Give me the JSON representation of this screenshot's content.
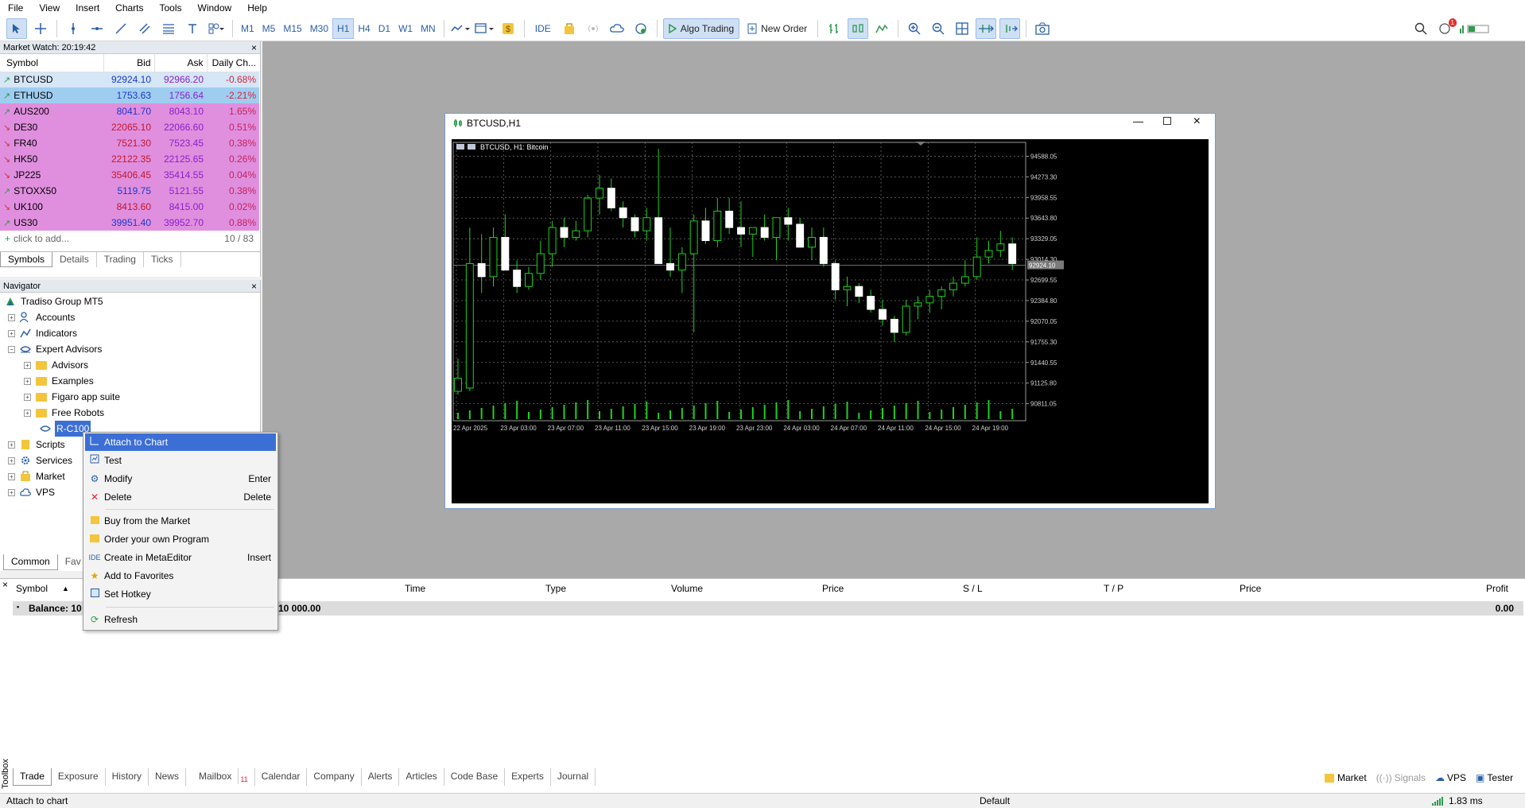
{
  "menubar": [
    "File",
    "View",
    "Insert",
    "Charts",
    "Tools",
    "Window",
    "Help"
  ],
  "toolbar": {
    "timeframes": [
      "M1",
      "M5",
      "M15",
      "M30",
      "H1",
      "H4",
      "D1",
      "W1",
      "MN"
    ],
    "active_timeframe": "H1",
    "ide_label": "IDE",
    "algo_trading_label": "Algo Trading",
    "new_order_label": "New Order",
    "notification_count": "1"
  },
  "market_watch": {
    "title": "Market Watch: 20:19:42",
    "headers": [
      "Symbol",
      "Bid",
      "Ask",
      "Daily Ch..."
    ],
    "rows": [
      {
        "symbol": "BTCUSD",
        "dir": "up",
        "bid": "92924.10",
        "ask": "92966.20",
        "change": "-0.68%"
      },
      {
        "symbol": "ETHUSD",
        "dir": "up",
        "bid": "1753.63",
        "ask": "1756.64",
        "change": "-2.21%"
      },
      {
        "symbol": "AUS200",
        "dir": "up",
        "bid": "8041.70",
        "ask": "8043.10",
        "change": "1.65%"
      },
      {
        "symbol": "DE30",
        "dir": "down",
        "bid": "22065.10",
        "ask": "22066.60",
        "change": "0.51%"
      },
      {
        "symbol": "FR40",
        "dir": "down",
        "bid": "7521.30",
        "ask": "7523.45",
        "change": "0.38%"
      },
      {
        "symbol": "HK50",
        "dir": "down",
        "bid": "22122.35",
        "ask": "22125.65",
        "change": "0.26%"
      },
      {
        "symbol": "JP225",
        "dir": "down",
        "bid": "35406.45",
        "ask": "35414.55",
        "change": "0.04%"
      },
      {
        "symbol": "STOXX50",
        "dir": "up",
        "bid": "5119.75",
        "ask": "5121.55",
        "change": "0.38%"
      },
      {
        "symbol": "UK100",
        "dir": "down",
        "bid": "8413.60",
        "ask": "8415.00",
        "change": "0.02%"
      },
      {
        "symbol": "US30",
        "dir": "up",
        "bid": "39951.40",
        "ask": "39952.70",
        "change": "0.88%"
      }
    ],
    "add_placeholder": "click to add...",
    "count": "10 / 83",
    "tabs": [
      "Symbols",
      "Details",
      "Trading",
      "Ticks"
    ]
  },
  "navigator": {
    "title": "Navigator",
    "root": "Tradiso Group MT5",
    "items": {
      "accounts": "Accounts",
      "indicators": "Indicators",
      "expert_advisors": "Expert Advisors",
      "advisors": "Advisors",
      "examples": "Examples",
      "figaro": "Figaro app suite",
      "free_robots": "Free Robots",
      "rc100": "R-C100",
      "scripts": "Scripts",
      "services": "Services",
      "market": "Market",
      "vps": "VPS"
    },
    "tabs": [
      "Common",
      "Fav"
    ]
  },
  "context_menu": {
    "items": [
      {
        "label": "Attach to Chart",
        "key": ""
      },
      {
        "label": "Test",
        "key": ""
      },
      {
        "label": "Modify",
        "key": "Enter"
      },
      {
        "label": "Delete",
        "key": "Delete"
      },
      {
        "label": "Buy from the Market",
        "key": ""
      },
      {
        "label": "Order your own Program",
        "key": ""
      },
      {
        "label": "Create in MetaEditor",
        "key": "Insert"
      },
      {
        "label": "Add to Favorites",
        "key": ""
      },
      {
        "label": "Set Hotkey",
        "key": ""
      },
      {
        "label": "Refresh",
        "key": ""
      }
    ]
  },
  "chart_window": {
    "title": "BTCUSD,H1",
    "label": "BTCUSD, H1:  Bitcoin",
    "current_price": "92924.10"
  },
  "chart_data": {
    "type": "candlestick",
    "price_ticks": [
      "94588.05",
      "94273.30",
      "93958.55",
      "93643.80",
      "93329.05",
      "93014.30",
      "92699.55",
      "92384.80",
      "92070.05",
      "91755.30",
      "91440.55",
      "91125.80",
      "90811.05"
    ],
    "time_ticks": [
      "22 Apr 2025",
      "23 Apr 03:00",
      "23 Apr 07:00",
      "23 Apr 11:00",
      "23 Apr 15:00",
      "23 Apr 19:00",
      "23 Apr 23:00",
      "24 Apr 03:00",
      "24 Apr 07:00",
      "24 Apr 11:00",
      "24 Apr 15:00",
      "24 Apr 19:00"
    ],
    "ylim": [
      90600,
      94800
    ],
    "candles": [
      {
        "o": 91000,
        "h": 91500,
        "l": 90950,
        "c": 91200
      },
      {
        "o": 91050,
        "h": 93500,
        "l": 91000,
        "c": 92950
      },
      {
        "o": 92950,
        "h": 93400,
        "l": 92500,
        "c": 92750
      },
      {
        "o": 92750,
        "h": 93500,
        "l": 92600,
        "c": 93350
      },
      {
        "o": 93350,
        "h": 93700,
        "l": 92900,
        "c": 92850
      },
      {
        "o": 92850,
        "h": 93000,
        "l": 92500,
        "c": 92600
      },
      {
        "o": 92600,
        "h": 92900,
        "l": 92550,
        "c": 92800
      },
      {
        "o": 92800,
        "h": 93300,
        "l": 92700,
        "c": 93100
      },
      {
        "o": 93100,
        "h": 93600,
        "l": 92900,
        "c": 93500
      },
      {
        "o": 93500,
        "h": 93650,
        "l": 93200,
        "c": 93350
      },
      {
        "o": 93350,
        "h": 93600,
        "l": 93300,
        "c": 93450
      },
      {
        "o": 93450,
        "h": 94000,
        "l": 93350,
        "c": 93950
      },
      {
        "o": 93950,
        "h": 94300,
        "l": 93700,
        "c": 94100
      },
      {
        "o": 94100,
        "h": 94250,
        "l": 93750,
        "c": 93800
      },
      {
        "o": 93800,
        "h": 93900,
        "l": 93500,
        "c": 93650
      },
      {
        "o": 93650,
        "h": 93700,
        "l": 93350,
        "c": 93450
      },
      {
        "o": 93450,
        "h": 93800,
        "l": 93300,
        "c": 93650
      },
      {
        "o": 93650,
        "h": 94700,
        "l": 92950,
        "c": 92950
      },
      {
        "o": 92950,
        "h": 93500,
        "l": 92750,
        "c": 92850
      },
      {
        "o": 92850,
        "h": 93200,
        "l": 92500,
        "c": 93100
      },
      {
        "o": 93100,
        "h": 93700,
        "l": 91900,
        "c": 93600
      },
      {
        "o": 93600,
        "h": 93800,
        "l": 93250,
        "c": 93300
      },
      {
        "o": 93300,
        "h": 93950,
        "l": 93200,
        "c": 93750
      },
      {
        "o": 93750,
        "h": 93950,
        "l": 93400,
        "c": 93500
      },
      {
        "o": 93500,
        "h": 93900,
        "l": 93200,
        "c": 93400
      },
      {
        "o": 93400,
        "h": 93500,
        "l": 93050,
        "c": 93500
      },
      {
        "o": 93500,
        "h": 93700,
        "l": 93300,
        "c": 93350
      },
      {
        "o": 93350,
        "h": 93650,
        "l": 93000,
        "c": 93650
      },
      {
        "o": 93650,
        "h": 93800,
        "l": 93300,
        "c": 93550
      },
      {
        "o": 93550,
        "h": 93650,
        "l": 93200,
        "c": 93200
      },
      {
        "o": 93200,
        "h": 93500,
        "l": 93000,
        "c": 93350
      },
      {
        "o": 93350,
        "h": 93500,
        "l": 92900,
        "c": 92950
      },
      {
        "o": 92950,
        "h": 93000,
        "l": 92400,
        "c": 92550
      },
      {
        "o": 92550,
        "h": 92750,
        "l": 92300,
        "c": 92600
      },
      {
        "o": 92600,
        "h": 92650,
        "l": 92350,
        "c": 92450
      },
      {
        "o": 92450,
        "h": 92550,
        "l": 92200,
        "c": 92250
      },
      {
        "o": 92250,
        "h": 92400,
        "l": 92000,
        "c": 92100
      },
      {
        "o": 92100,
        "h": 92150,
        "l": 91750,
        "c": 91900
      },
      {
        "o": 91900,
        "h": 92400,
        "l": 91850,
        "c": 92300
      },
      {
        "o": 92300,
        "h": 92450,
        "l": 92100,
        "c": 92350
      },
      {
        "o": 92350,
        "h": 92550,
        "l": 92200,
        "c": 92450
      },
      {
        "o": 92450,
        "h": 92600,
        "l": 92250,
        "c": 92550
      },
      {
        "o": 92550,
        "h": 92750,
        "l": 92450,
        "c": 92650
      },
      {
        "o": 92650,
        "h": 93000,
        "l": 92600,
        "c": 92750
      },
      {
        "o": 92750,
        "h": 93350,
        "l": 92700,
        "c": 93050
      },
      {
        "o": 93050,
        "h": 93300,
        "l": 92950,
        "c": 93150
      },
      {
        "o": 93150,
        "h": 93450,
        "l": 93050,
        "c": 93250
      },
      {
        "o": 93250,
        "h": 93350,
        "l": 92850,
        "c": 92950
      }
    ]
  },
  "trade_table": {
    "headers": [
      "Symbol",
      "Time",
      "Type",
      "Volume",
      "Price",
      "S / L",
      "T / P",
      "Price",
      "Profit"
    ],
    "balance_label": "Balance: 10",
    "balance_value": "10 000.00",
    "profit": "0.00"
  },
  "toolbox_tabs": [
    "Trade",
    "Exposure",
    "History",
    "News",
    "Mailbox",
    "Calendar",
    "Company",
    "Alerts",
    "Articles",
    "Code Base",
    "Experts",
    "Journal"
  ],
  "mailbox_count": "11",
  "toolbox_label": "Toolbox",
  "toolbox_right": [
    "Market",
    "Signals",
    "VPS",
    "Tester"
  ],
  "status": {
    "left": "Attach to chart",
    "profile": "Default",
    "ping": "1.83 ms"
  }
}
